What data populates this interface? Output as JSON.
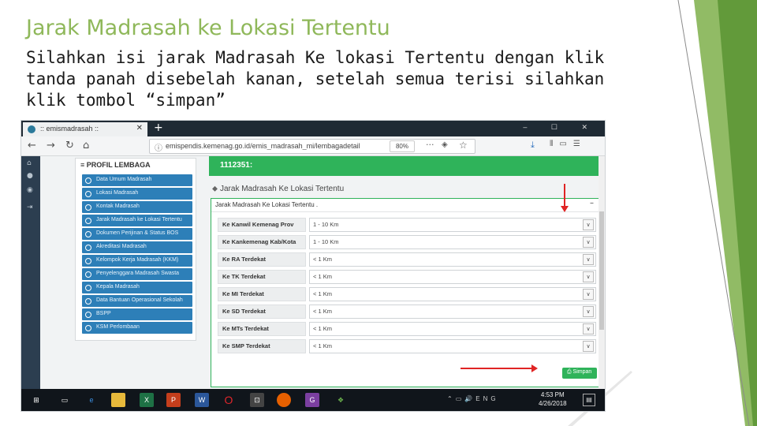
{
  "slide": {
    "title": "Jarak Madrasah ke Lokasi Tertentu",
    "body_lines": [
      "Silahkan isi jarak Madrasah Ke lokasi Tertentu dengan klik",
      "tanda panah disebelah kanan, setelah semua terisi silahkan",
      "klik tombol “simpan”"
    ],
    "accent_color": "#8fb85a",
    "arrow_color": "#e02424"
  },
  "browser": {
    "tab_title": ":: emismadrasah ::",
    "new_tab_glyph": "+",
    "url": "emispendis.kemenag.go.id/emis_madrasah_mi/lembagadetail",
    "zoom": "80%",
    "back_glyph": "←",
    "forward_glyph": "→",
    "reload_glyph": "↻",
    "home_glyph": "⌂",
    "more_glyph": "···",
    "star_glyph": "☆",
    "download_glyph": "⤓",
    "window_buttons": "– ☐ ✕"
  },
  "left_panel": {
    "heading": "≡ PROFIL LEMBAGA",
    "items": [
      "Data Umum Madrasah",
      "Lokasi Madrasah",
      "Kontak Madrasah",
      "Jarak Madrasah ke Lokasi Tertentu",
      "Dokumen Perijinan & Status BOS",
      "Akreditasi Madrasah",
      "Kelompok Kerja Madrasah (KKM)",
      "Penyelenggara Madrasah Swasta",
      "Kepala Madrasah",
      "Data Bantuan Operasional Sekolah",
      "BSPP",
      "KSM Perlombaan"
    ]
  },
  "green_header": {
    "text": "1112351:"
  },
  "section": {
    "title": "Jarak Madrasah Ke Lokasi Tertentu",
    "form_title": "Jarak Madrasah Ke Lokasi Tertentu .",
    "collapse_glyph": "–",
    "rows": [
      {
        "label": "Ke Kanwil Kemenag Prov",
        "value": "1 - 10 Km"
      },
      {
        "label": "Ke Kankemenag Kab/Kota",
        "value": "1 - 10 Km"
      },
      {
        "label": "Ke RA Terdekat",
        "value": "< 1 Km"
      },
      {
        "label": "Ke TK Terdekat",
        "value": "< 1 Km"
      },
      {
        "label": "Ke MI Terdekat",
        "value": "< 1 Km"
      },
      {
        "label": "Ke SD Terdekat",
        "value": "< 1 Km"
      },
      {
        "label": "Ke MTs Terdekat",
        "value": "< 1 Km"
      },
      {
        "label": "Ke SMP Terdekat",
        "value": "< 1 Km"
      }
    ],
    "save_label": "⎙ Simpan"
  },
  "taskbar": {
    "apps": [
      "start",
      "task-view",
      "edge",
      "file-explorer",
      "excel",
      "powerpoint",
      "word",
      "opera",
      "store",
      "firefox",
      "app",
      "tray-app"
    ],
    "tray_text": "ENG",
    "time": "4:53 PM",
    "date": "4/26/2018"
  }
}
